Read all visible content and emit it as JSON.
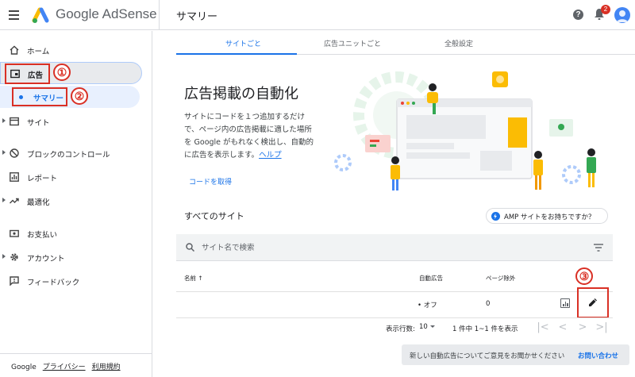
{
  "header": {
    "logo_text": "Google AdSense",
    "page_title": "サマリー",
    "notification_count": "2",
    "help_glyph": "?"
  },
  "sidebar": {
    "items": [
      {
        "label": "ホーム",
        "icon": "home-icon"
      },
      {
        "label": "広告",
        "icon": "ads-icon"
      },
      {
        "label": "サマリー",
        "icon": "dot"
      },
      {
        "label": "サイト",
        "icon": "site-icon"
      },
      {
        "label": "ブロックのコントロール",
        "icon": "block-icon"
      },
      {
        "label": "レポート",
        "icon": "report-icon"
      },
      {
        "label": "最適化",
        "icon": "trending-icon"
      },
      {
        "label": "お支払い",
        "icon": "payment-icon"
      },
      {
        "label": "アカウント",
        "icon": "gear-icon"
      },
      {
        "label": "フィードバック",
        "icon": "feedback-icon"
      }
    ],
    "footer": {
      "brand": "Google",
      "privacy": "プライバシー",
      "terms": "利用規約"
    }
  },
  "annotations": {
    "one": "①",
    "two": "②",
    "three": "③",
    "color": "#d93025"
  },
  "tabs": [
    {
      "label": "サイトごと",
      "active": true
    },
    {
      "label": "広告ユニットごと",
      "active": false
    },
    {
      "label": "全般設定",
      "active": false
    }
  ],
  "hero": {
    "title": "広告掲載の自動化",
    "desc_1": "サイトにコードを１つ追加するだけ",
    "desc_2": "で、ページ内の広告掲載に適した場所",
    "desc_3": "を Google がもれなく検出し、自動的",
    "desc_4": "に広告を表示します。",
    "help_link": "ヘルプ",
    "get_code": "コードを取得"
  },
  "sites": {
    "title": "すべてのサイト",
    "amp_button": "AMP サイトをお持ちですか？",
    "search_placeholder": "サイト名で検索",
    "columns": {
      "name": "名前",
      "sort_glyph": "↑",
      "auto_ads": "自動広告",
      "page_exclusions": "ページ除外"
    },
    "rows": [
      {
        "name": "",
        "auto_ads": "• オフ",
        "page_exclusions": "0"
      }
    ],
    "pagination": {
      "rows_label": "表示行数:",
      "rows_value": "10",
      "range": "1 件中 1~1 件を表示"
    }
  },
  "feedback": {
    "text": "新しい自動広告についてご意見をお聞かせください",
    "link": "お問い合わせ"
  },
  "colors": {
    "accent": "#1a73e8",
    "annotation_red": "#d93025"
  }
}
